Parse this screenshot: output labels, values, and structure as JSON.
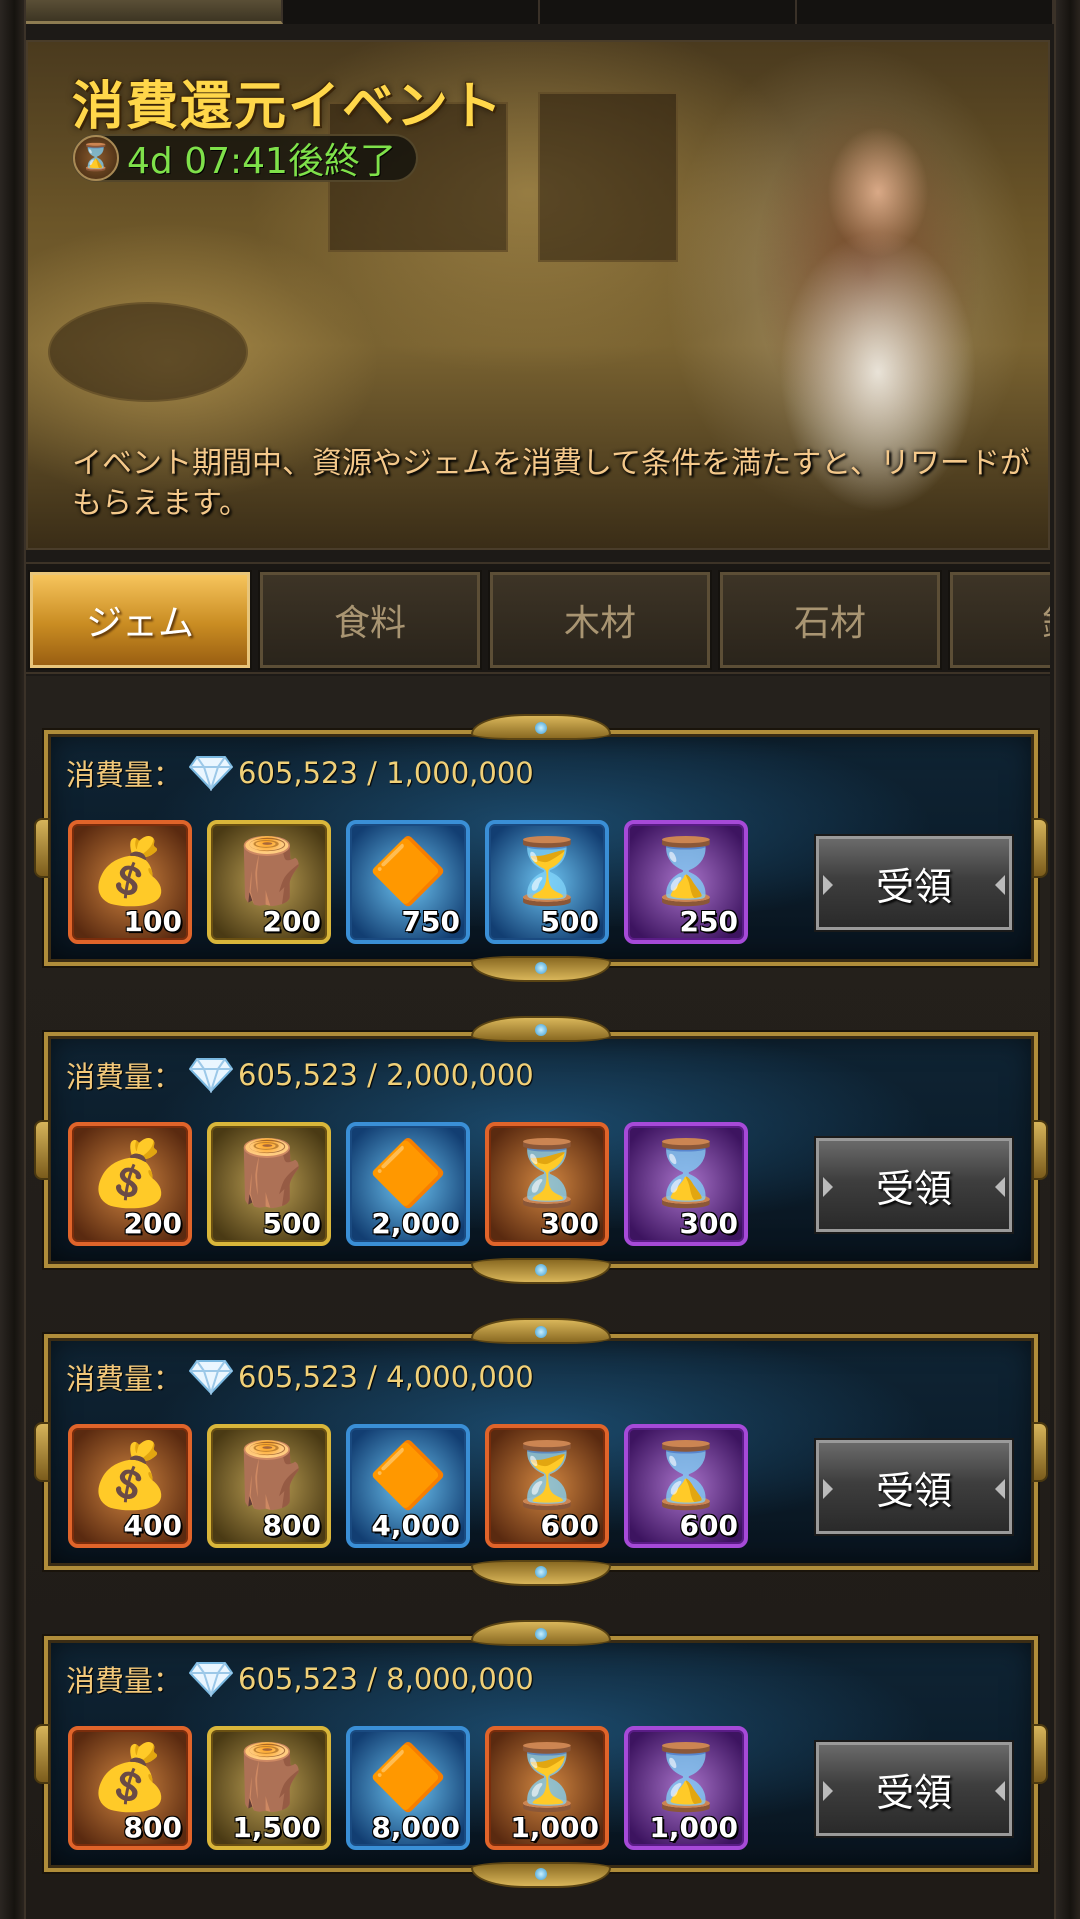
{
  "banner": {
    "title": "消費還元イベント",
    "timer": "4d 07:41後終了",
    "description": "イベント期間中、資源やジェムを消費して条件を満たすと、リワードがもらえます。"
  },
  "tabs": [
    {
      "label": "ジェム",
      "active": true
    },
    {
      "label": "食料",
      "active": false
    },
    {
      "label": "木材",
      "active": false
    },
    {
      "label": "石材",
      "active": false
    },
    {
      "label": "鉱",
      "active": false
    }
  ],
  "colors": {
    "accent_gold": "#ffd74a",
    "timer_green": "#7fe14a",
    "card_border": "#b08d3a"
  },
  "tiers": [
    {
      "label": "消費量：",
      "progress": "605,523 / 1,000,000",
      "claim_label": "受領",
      "rewards": [
        {
          "icon": "resource-bag-icon",
          "rarity": "orange",
          "qty": "100"
        },
        {
          "icon": "lumber-crate-icon",
          "rarity": "gold",
          "qty": "200"
        },
        {
          "icon": "orange-crystal-icon",
          "rarity": "blue",
          "qty": "750"
        },
        {
          "icon": "speedup-hourglass-icon",
          "rarity": "blue",
          "qty": "500"
        },
        {
          "icon": "build-hourglass-icon",
          "rarity": "purple",
          "qty": "250"
        }
      ]
    },
    {
      "label": "消費量：",
      "progress": "605,523 / 2,000,000",
      "claim_label": "受領",
      "rewards": [
        {
          "icon": "resource-bag-icon",
          "rarity": "orange",
          "qty": "200"
        },
        {
          "icon": "lumber-crate-icon",
          "rarity": "gold",
          "qty": "500"
        },
        {
          "icon": "orange-crystal-icon",
          "rarity": "blue",
          "qty": "2,000"
        },
        {
          "icon": "speedup-hourglass-icon",
          "rarity": "orange",
          "qty": "300"
        },
        {
          "icon": "build-hourglass-icon",
          "rarity": "purple",
          "qty": "300"
        }
      ]
    },
    {
      "label": "消費量：",
      "progress": "605,523 / 4,000,000",
      "claim_label": "受領",
      "rewards": [
        {
          "icon": "resource-bag-icon",
          "rarity": "orange",
          "qty": "400"
        },
        {
          "icon": "lumber-crate-icon",
          "rarity": "gold",
          "qty": "800"
        },
        {
          "icon": "orange-crystal-icon",
          "rarity": "blue",
          "qty": "4,000"
        },
        {
          "icon": "speedup-hourglass-icon",
          "rarity": "orange",
          "qty": "600"
        },
        {
          "icon": "build-hourglass-icon",
          "rarity": "purple",
          "qty": "600"
        }
      ]
    },
    {
      "label": "消費量：",
      "progress": "605,523 / 8,000,000",
      "claim_label": "受領",
      "rewards": [
        {
          "icon": "resource-bag-icon",
          "rarity": "orange",
          "qty": "800"
        },
        {
          "icon": "lumber-crate-icon",
          "rarity": "gold",
          "qty": "1,500"
        },
        {
          "icon": "orange-crystal-icon",
          "rarity": "blue",
          "qty": "8,000"
        },
        {
          "icon": "speedup-hourglass-icon",
          "rarity": "orange",
          "qty": "1,000"
        },
        {
          "icon": "build-hourglass-icon",
          "rarity": "purple",
          "qty": "1,000"
        }
      ]
    }
  ]
}
